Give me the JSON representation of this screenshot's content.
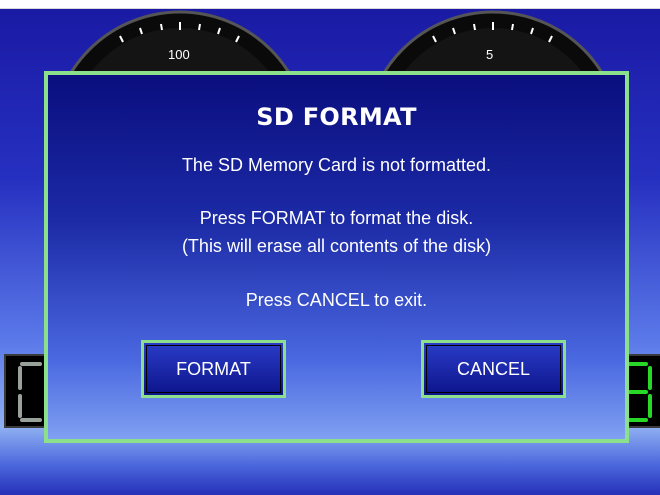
{
  "dialog": {
    "title": "SD FORMAT",
    "message_line1": "The SD Memory Card is not formatted.",
    "message_line2": "Press FORMAT to format the disk.",
    "message_line3": "(This will erase all contents of the disk)",
    "message_line4": "Press CANCEL to exit.",
    "format_button": "FORMAT",
    "cancel_button": "CANCEL"
  },
  "background": {
    "left_gauge_label": "100",
    "right_gauge_label": "5"
  },
  "colors": {
    "dialog_border": "#8ce08c",
    "accent_red": "#e02020",
    "digit_green": "#27d827"
  }
}
